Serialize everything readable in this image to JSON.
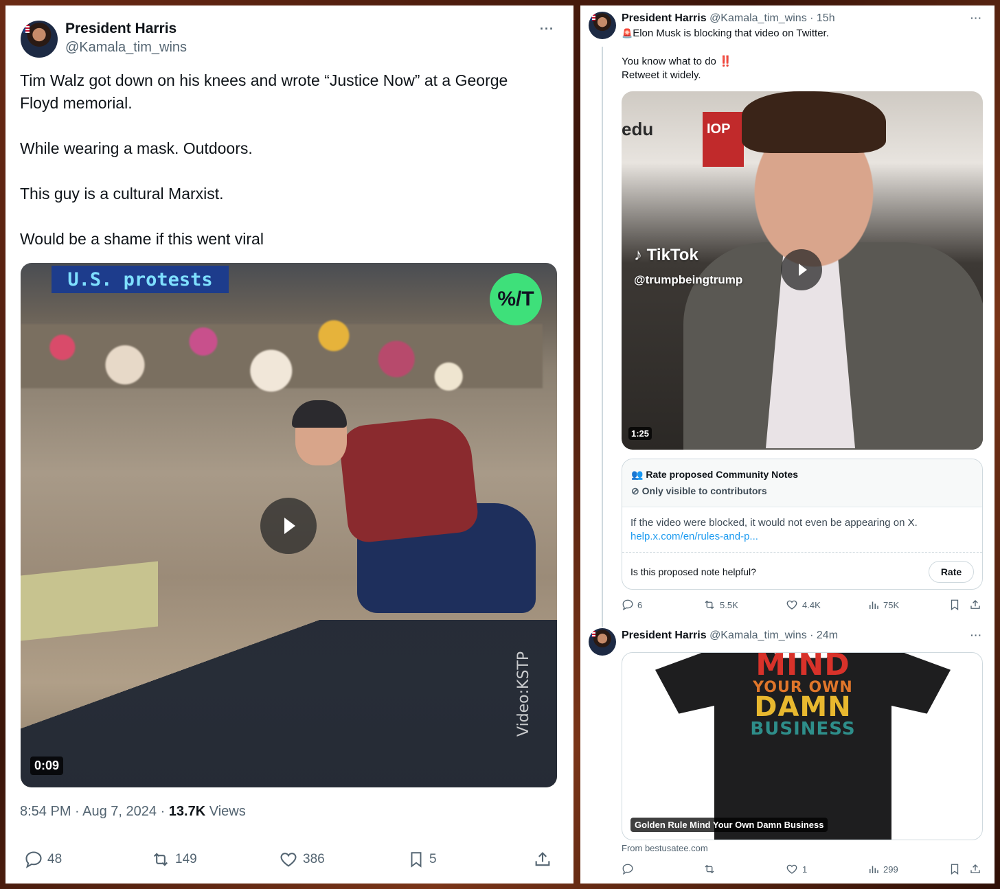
{
  "left_tweet": {
    "name": "President Harris",
    "handle": "@Kamala_tim_wins",
    "more": "···",
    "body": [
      "Tim Walz got down on his knees and wrote “Justice Now” at a George",
      "Floyd memorial.",
      "While wearing a mask. Outdoors.",
      "This guy is a cultural Marxist.",
      "Would be a shame if this went viral"
    ],
    "video": {
      "banner": "U.S. protests",
      "logo": "%/T",
      "watermark": "Video:KSTP",
      "duration": "0:09"
    },
    "meta_time": "8:54 PM · Aug 7, 2024 · ",
    "meta_views_count": "13.7K",
    "meta_views_label": " Views",
    "actions": {
      "replies": "48",
      "reposts": "149",
      "likes": "386",
      "bookmarks": "5"
    }
  },
  "right_tweet_1": {
    "name": "President Harris",
    "handle_time": "@Kamala_tim_wins · 15h",
    "more": "···",
    "alert_emoji": "🚨",
    "line1": "Elon Musk is blocking that video on Twitter.",
    "line2": "You know what to do ",
    "line2_emoji": "‼️",
    "line3": "Retweet it widely.",
    "video": {
      "tiktok_brand": "TikTok",
      "tiktok_user": "@trumpbeingtrump",
      "duration": "1:25",
      "edu": "edu",
      "sign": "IOP"
    },
    "community_note": {
      "title": "Rate proposed Community Notes",
      "subtitle": "Only visible to contributors",
      "text": "If the video were blocked, it would not even be appearing on X.",
      "link": "help.x.com/en/rules-and-p...",
      "question": "Is this proposed note helpful?",
      "rate_button": "Rate"
    },
    "actions": {
      "replies": "6",
      "reposts": "5.5K",
      "likes": "4.4K",
      "views": "75K"
    }
  },
  "right_tweet_2": {
    "name": "President Harris",
    "handle_time": "@Kamala_tim_wins · 24m",
    "more": "···",
    "card": {
      "shirt_line1": "MIND",
      "shirt_line2": "YOUR OWN",
      "shirt_line3": "DAMN",
      "shirt_line4": "BUSINESS",
      "label": "Golden Rule Mind Your Own Damn Business",
      "source": "From bestusatee.com"
    },
    "actions": {
      "replies": "",
      "reposts": "",
      "likes": "1",
      "views": "299"
    }
  },
  "colors": {
    "text": "#0f1419",
    "muted": "#536471",
    "link": "#1d9bf0",
    "border": "#cfd9de"
  }
}
